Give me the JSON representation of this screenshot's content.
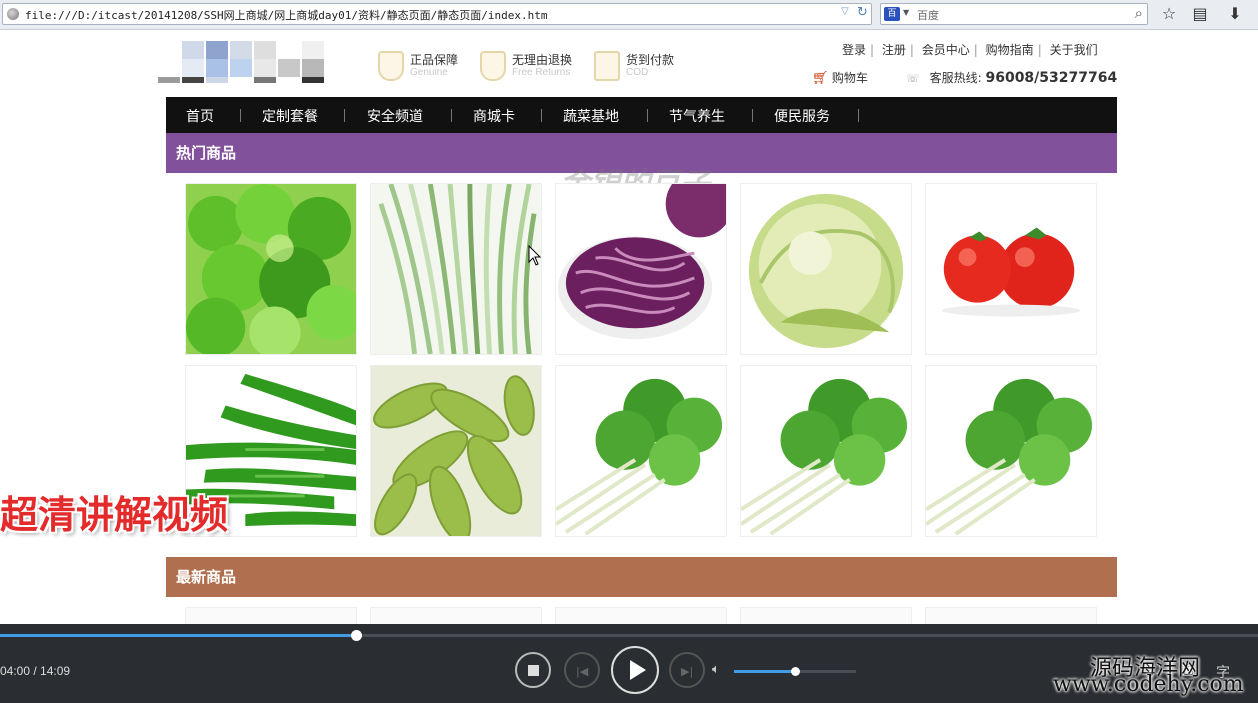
{
  "browser": {
    "url": "file:///D:/itcast/20141208/SSH网上商城/网上商城day01/资料/静态页面/静态页面/index.htm",
    "search_placeholder": "百度",
    "search_engine_icon": "baidu-paw-icon",
    "toolbar_icons": [
      "bookmark-star-icon",
      "clipboard-icon",
      "download-arrow-icon"
    ]
  },
  "header": {
    "promises": [
      {
        "title": "正品保障",
        "subtitle": "Genuine"
      },
      {
        "title": "无理由退换",
        "subtitle": "Free Returns"
      },
      {
        "title": "货到付款",
        "subtitle": "COD"
      }
    ],
    "top_links": [
      "登录",
      "注册",
      "会员中心",
      "购物指南",
      "关于我们"
    ],
    "cart_label": "购物车",
    "hotline_label": "客服热线:",
    "hotline_number": "96008/53277764"
  },
  "nav": {
    "items": [
      "首页",
      "定制套餐",
      "安全频道",
      "商城卡",
      "蔬菜基地",
      "节气养生",
      "便民服务"
    ]
  },
  "sections": {
    "hot_title": "热门商品",
    "new_title": "最新商品"
  },
  "hot_products": [
    {
      "image": "parsley"
    },
    {
      "image": "chives"
    },
    {
      "image": "red-cabbage"
    },
    {
      "image": "lettuce"
    },
    {
      "image": "tomato"
    },
    {
      "image": "green-pepper"
    },
    {
      "image": "snow-peas"
    },
    {
      "image": "coriander"
    },
    {
      "image": "coriander"
    },
    {
      "image": "coriander"
    }
  ],
  "overlays": {
    "watermark": "金银的豆子",
    "caption": "超清讲解视频",
    "site_name": "源码海洋网",
    "site_url": "www.codehy.com"
  },
  "player": {
    "time": "04:00 / 14:09",
    "progress_fraction": 0.2827,
    "volume_fraction": 0.5,
    "controls": [
      "stop",
      "previous",
      "play",
      "next",
      "volume"
    ],
    "extra_controls": [
      "fullscreen-icon",
      "window-icon",
      "字"
    ]
  }
}
